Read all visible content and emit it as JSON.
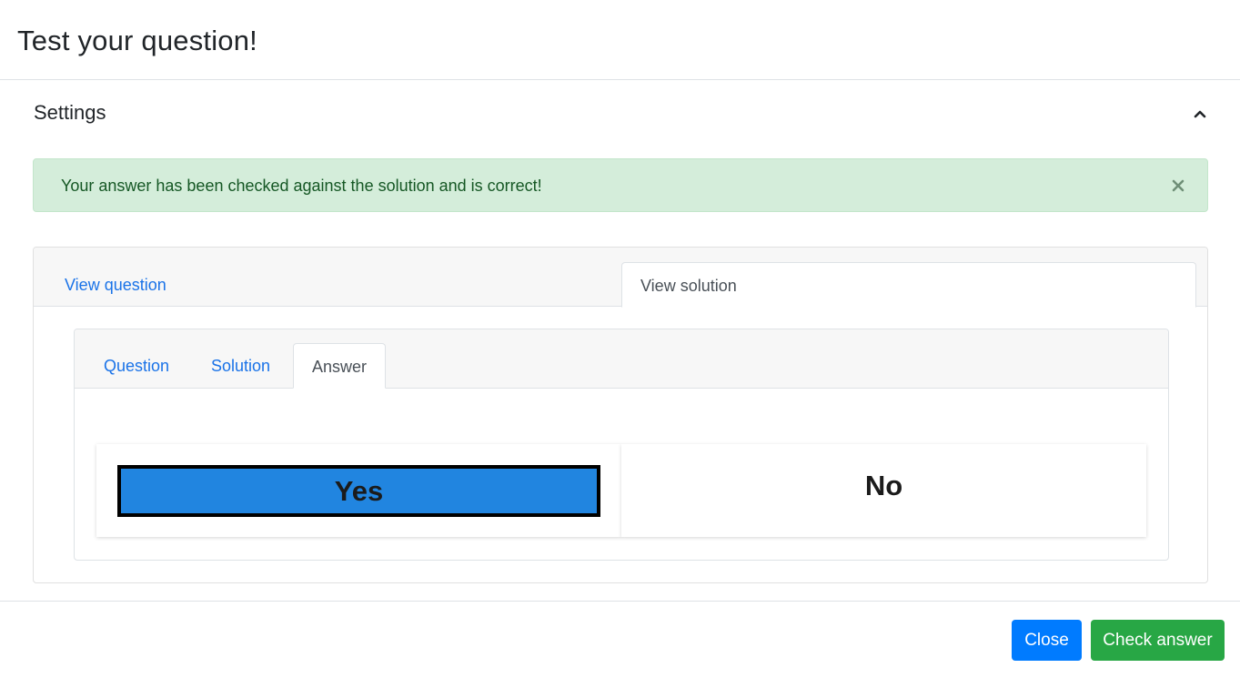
{
  "modal": {
    "title": "Test your question!"
  },
  "settings": {
    "label": "Settings",
    "toggle_icon": "chevron-up-icon"
  },
  "alert": {
    "message": "Your answer has been checked against the solution and is correct!",
    "close_icon": "close-icon",
    "color": "#d4edda"
  },
  "outer_tabs": {
    "view_question": "View question",
    "view_solution": "View solution",
    "active": "View solution"
  },
  "inner_tabs": {
    "question": "Question",
    "solution": "Solution",
    "answer": "Answer",
    "active": "Answer"
  },
  "answer": {
    "choices": [
      "Yes",
      "No"
    ],
    "selected": "Yes",
    "selected_color": "#2185e0"
  },
  "footer": {
    "close_label": "Close",
    "check_label": "Check answer",
    "close_color": "#007bff",
    "check_color": "#28a745"
  }
}
